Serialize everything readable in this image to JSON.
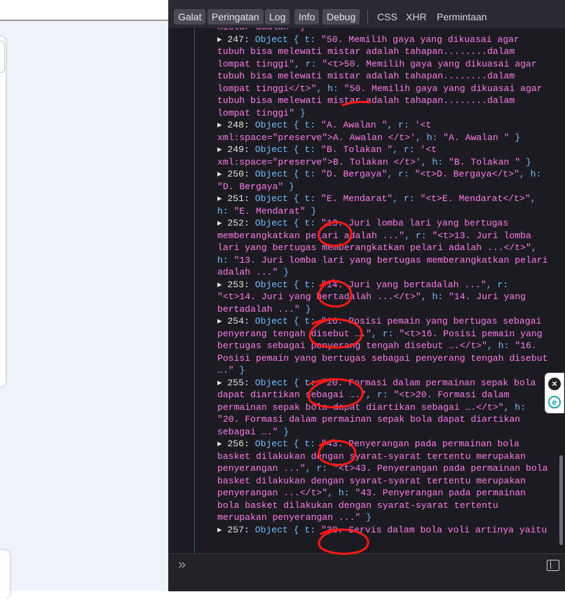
{
  "toolbar": {
    "filters": [
      "Galat",
      "Peringatan",
      "Log",
      "Info",
      "Debug"
    ],
    "links": [
      "CSS",
      "XHR",
      "Permintaan"
    ]
  },
  "console_lines": [
    {
      "parts": [
        {
          "t": "mistar adalah\" }",
          "c": "str"
        }
      ]
    },
    {
      "parts": [
        {
          "t": "▸ 247: ",
          "c": "key"
        },
        {
          "t": "Object { t: ",
          "c": "obj"
        },
        {
          "t": "\"50. Memilih gaya yang dikuasai agar",
          "c": "str"
        }
      ]
    },
    {
      "parts": [
        {
          "t": "tubuh bisa melewati mistar adalah tahapan........dalam",
          "c": "str"
        }
      ]
    },
    {
      "parts": [
        {
          "t": "lompat tinggi\"",
          "c": "str"
        },
        {
          "t": ", r: ",
          "c": "obj"
        },
        {
          "t": "\"<t>50. Memilih gaya yang dikuasai agar",
          "c": "str"
        }
      ]
    },
    {
      "parts": [
        {
          "t": "tubuh bisa melewati mistar adalah tahapan........dalam",
          "c": "str"
        }
      ]
    },
    {
      "parts": [
        {
          "t": "lompat tinggi</t>\"",
          "c": "str"
        },
        {
          "t": ", h: ",
          "c": "obj"
        },
        {
          "t": "\"50. Memilih gaya yang dikuasai agar",
          "c": "str"
        }
      ]
    },
    {
      "parts": [
        {
          "t": "tubuh bisa melewati mistar adalah tahapan........dalam",
          "c": "str"
        }
      ]
    },
    {
      "parts": [
        {
          "t": "lompat tinggi\"",
          "c": "str"
        },
        {
          "t": " }",
          "c": "obj"
        }
      ]
    },
    {
      "parts": [
        {
          "t": "▸ 248: ",
          "c": "key"
        },
        {
          "t": "Object { t: ",
          "c": "obj"
        },
        {
          "t": "\"A. Awalan \"",
          "c": "str"
        },
        {
          "t": ", r: ",
          "c": "obj"
        },
        {
          "t": "'<t",
          "c": "str"
        }
      ]
    },
    {
      "parts": [
        {
          "t": "xml:space=\"preserve\">A. Awalan </t>'",
          "c": "str"
        },
        {
          "t": ", h: ",
          "c": "obj"
        },
        {
          "t": "\"A. Awalan \"",
          "c": "str"
        },
        {
          "t": " }",
          "c": "obj"
        }
      ]
    },
    {
      "parts": [
        {
          "t": "▸ 249: ",
          "c": "key"
        },
        {
          "t": "Object { t: ",
          "c": "obj"
        },
        {
          "t": "\"B. Tolakan \"",
          "c": "str"
        },
        {
          "t": ", r: ",
          "c": "obj"
        },
        {
          "t": "'<t",
          "c": "str"
        }
      ]
    },
    {
      "parts": [
        {
          "t": "xml:space=\"preserve\">B. Tolakan </t>'",
          "c": "str"
        },
        {
          "t": ", h: ",
          "c": "obj"
        },
        {
          "t": "\"B. Tolakan \"",
          "c": "str"
        },
        {
          "t": " }",
          "c": "obj"
        }
      ]
    },
    {
      "parts": [
        {
          "t": "▸ 250: ",
          "c": "key"
        },
        {
          "t": "Object { t: ",
          "c": "obj"
        },
        {
          "t": "\"D. Bergaya\"",
          "c": "str"
        },
        {
          "t": ", r: ",
          "c": "obj"
        },
        {
          "t": "\"<t>D. Bergaya</t>\"",
          "c": "str"
        },
        {
          "t": ", h:",
          "c": "obj"
        }
      ]
    },
    {
      "parts": [
        {
          "t": "\"D. Bergaya\"",
          "c": "str"
        },
        {
          "t": " }",
          "c": "obj"
        }
      ]
    },
    {
      "parts": [
        {
          "t": "▸ 251: ",
          "c": "key"
        },
        {
          "t": "Object { t: ",
          "c": "obj"
        },
        {
          "t": "\"E. Mendarat\"",
          "c": "str"
        },
        {
          "t": ", r: ",
          "c": "obj"
        },
        {
          "t": "\"<t>E. Mendarat</t>\"",
          "c": "str"
        },
        {
          "t": ",",
          "c": "obj"
        }
      ]
    },
    {
      "parts": [
        {
          "t": "h: ",
          "c": "obj"
        },
        {
          "t": "\"E. Mendarat\"",
          "c": "str"
        },
        {
          "t": " }",
          "c": "obj"
        }
      ]
    },
    {
      "parts": [
        {
          "t": "▸ 252: ",
          "c": "key"
        },
        {
          "t": "Object { t: ",
          "c": "obj"
        },
        {
          "t": "\"13. Juri lomba lari yang bertugas",
          "c": "str"
        }
      ]
    },
    {
      "parts": [
        {
          "t": "memberangkatkan pelari adalah ...\"",
          "c": "str"
        },
        {
          "t": ", r: ",
          "c": "obj"
        },
        {
          "t": "\"<t>13. Juri lomba",
          "c": "str"
        }
      ]
    },
    {
      "parts": [
        {
          "t": "lari yang bertugas memberangkatkan pelari adalah ...</t>\"",
          "c": "str"
        },
        {
          "t": ",",
          "c": "obj"
        }
      ]
    },
    {
      "parts": [
        {
          "t": "h: ",
          "c": "obj"
        },
        {
          "t": "\"13. Juri lomba lari yang bertugas memberangkatkan pelari",
          "c": "str"
        }
      ]
    },
    {
      "parts": [
        {
          "t": "adalah ...\"",
          "c": "str"
        },
        {
          "t": " }",
          "c": "obj"
        }
      ]
    },
    {
      "parts": [
        {
          "t": "▸ 253: ",
          "c": "key"
        },
        {
          "t": "Object { t: ",
          "c": "obj"
        },
        {
          "t": "\"14. Juri yang bertadalah ...\"",
          "c": "str"
        },
        {
          "t": ", r:",
          "c": "obj"
        }
      ]
    },
    {
      "parts": [
        {
          "t": "\"<t>14. Juri yang bertadalah ...</t>\"",
          "c": "str"
        },
        {
          "t": ", h: ",
          "c": "obj"
        },
        {
          "t": "\"14. Juri yang",
          "c": "str"
        }
      ]
    },
    {
      "parts": [
        {
          "t": "bertadalah ...\"",
          "c": "str"
        },
        {
          "t": " }",
          "c": "obj"
        }
      ]
    },
    {
      "parts": [
        {
          "t": "▸ 254: ",
          "c": "key"
        },
        {
          "t": "Object { t: ",
          "c": "obj"
        },
        {
          "t": "\"16. Posisi pemain yang bertugas sebagai",
          "c": "str"
        }
      ]
    },
    {
      "parts": [
        {
          "t": "penyerang tengah disebut ….\"",
          "c": "str"
        },
        {
          "t": ", r: ",
          "c": "obj"
        },
        {
          "t": "\"<t>16. Posisi pemain yang",
          "c": "str"
        }
      ]
    },
    {
      "parts": [
        {
          "t": "bertugas sebagai penyerang tengah disebut ….</t>\"",
          "c": "str"
        },
        {
          "t": ", h: ",
          "c": "obj"
        },
        {
          "t": "\"16.",
          "c": "str"
        }
      ]
    },
    {
      "parts": [
        {
          "t": "Posisi pemain yang bertugas sebagai penyerang tengah disebut",
          "c": "str"
        }
      ]
    },
    {
      "parts": [
        {
          "t": "….\"",
          "c": "str"
        },
        {
          "t": " }",
          "c": "obj"
        }
      ]
    },
    {
      "parts": [
        {
          "t": "▸ 255: ",
          "c": "key"
        },
        {
          "t": "Object { t: ",
          "c": "obj"
        },
        {
          "t": "\"20. Formasi dalam permainan sepak bola",
          "c": "str"
        }
      ]
    },
    {
      "parts": [
        {
          "t": "dapat diartikan sebagai ….\"",
          "c": "str"
        },
        {
          "t": ", r: ",
          "c": "obj"
        },
        {
          "t": "\"<t>20. Formasi dalam",
          "c": "str"
        }
      ]
    },
    {
      "parts": [
        {
          "t": "permainan sepak bola dapat diartikan sebagai ….</t>\"",
          "c": "str"
        },
        {
          "t": ", h:",
          "c": "obj"
        }
      ]
    },
    {
      "parts": [
        {
          "t": "\"20. Formasi dalam permainan sepak bola dapat diartikan",
          "c": "str"
        }
      ]
    },
    {
      "parts": [
        {
          "t": "sebagai ….\"",
          "c": "str"
        },
        {
          "t": " }",
          "c": "obj"
        }
      ]
    },
    {
      "parts": [
        {
          "t": "▸ 256: ",
          "c": "key"
        },
        {
          "t": "Object { t: ",
          "c": "obj"
        },
        {
          "t": "\"43. Penyerangan pada permainan bola",
          "c": "str"
        }
      ]
    },
    {
      "parts": [
        {
          "t": "basket dilakukan dengan syarat-syarat tertentu merupakan",
          "c": "str"
        }
      ]
    },
    {
      "parts": [
        {
          "t": "penyerangan ...\"",
          "c": "str"
        },
        {
          "t": ", r: ",
          "c": "obj"
        },
        {
          "t": "\"<t>43. Penyerangan pada permainan bola",
          "c": "str"
        }
      ]
    },
    {
      "parts": [
        {
          "t": "basket dilakukan dengan syarat-syarat tertentu merupakan",
          "c": "str"
        }
      ]
    },
    {
      "parts": [
        {
          "t": "penyerangan ...</t>\"",
          "c": "str"
        },
        {
          "t": ", h: ",
          "c": "obj"
        },
        {
          "t": "\"43. Penyerangan pada permainan",
          "c": "str"
        }
      ]
    },
    {
      "parts": [
        {
          "t": "bola basket dilakukan dengan syarat-syarat tertentu",
          "c": "str"
        }
      ]
    },
    {
      "parts": [
        {
          "t": "merupakan penyerangan ...\"",
          "c": "str"
        },
        {
          "t": " }",
          "c": "obj"
        }
      ]
    },
    {
      "parts": [
        {
          "t": "▸ 257: ",
          "c": "key"
        },
        {
          "t": "Object { t: ",
          "c": "obj"
        },
        {
          "t": "\"38. Servis dalam bola voli artinya yaitu",
          "c": "str"
        }
      ]
    }
  ],
  "input": {
    "prompt": "»"
  },
  "colors": {
    "string": "#ff7de9",
    "object": "#75bfff",
    "annotation": "#ff1a1a",
    "panel": "#1c1b22"
  }
}
